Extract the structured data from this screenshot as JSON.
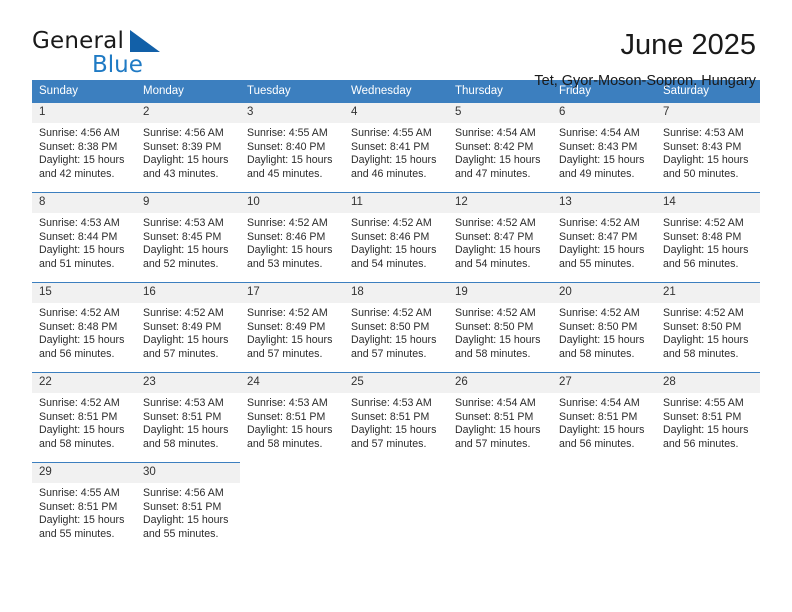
{
  "brand": {
    "name_top": "General",
    "name_bottom": "Blue",
    "triangle_icon": "triangle-icon",
    "accent_color": "#1f7ac4",
    "triangle_color": "#1260a8"
  },
  "header": {
    "title": "June 2025",
    "subtitle": "Tet, Gyor-Moson-Sopron, Hungary"
  },
  "calendar": {
    "header_bg": "#3c7fbf",
    "daynum_bg": "#f1f1f1",
    "weekdays": [
      "Sunday",
      "Monday",
      "Tuesday",
      "Wednesday",
      "Thursday",
      "Friday",
      "Saturday"
    ],
    "weeks": [
      [
        {
          "day": "1",
          "sunrise": "Sunrise: 4:56 AM",
          "sunset": "Sunset: 8:38 PM",
          "daylight1": "Daylight: 15 hours",
          "daylight2": "and 42 minutes."
        },
        {
          "day": "2",
          "sunrise": "Sunrise: 4:56 AM",
          "sunset": "Sunset: 8:39 PM",
          "daylight1": "Daylight: 15 hours",
          "daylight2": "and 43 minutes."
        },
        {
          "day": "3",
          "sunrise": "Sunrise: 4:55 AM",
          "sunset": "Sunset: 8:40 PM",
          "daylight1": "Daylight: 15 hours",
          "daylight2": "and 45 minutes."
        },
        {
          "day": "4",
          "sunrise": "Sunrise: 4:55 AM",
          "sunset": "Sunset: 8:41 PM",
          "daylight1": "Daylight: 15 hours",
          "daylight2": "and 46 minutes."
        },
        {
          "day": "5",
          "sunrise": "Sunrise: 4:54 AM",
          "sunset": "Sunset: 8:42 PM",
          "daylight1": "Daylight: 15 hours",
          "daylight2": "and 47 minutes."
        },
        {
          "day": "6",
          "sunrise": "Sunrise: 4:54 AM",
          "sunset": "Sunset: 8:43 PM",
          "daylight1": "Daylight: 15 hours",
          "daylight2": "and 49 minutes."
        },
        {
          "day": "7",
          "sunrise": "Sunrise: 4:53 AM",
          "sunset": "Sunset: 8:43 PM",
          "daylight1": "Daylight: 15 hours",
          "daylight2": "and 50 minutes."
        }
      ],
      [
        {
          "day": "8",
          "sunrise": "Sunrise: 4:53 AM",
          "sunset": "Sunset: 8:44 PM",
          "daylight1": "Daylight: 15 hours",
          "daylight2": "and 51 minutes."
        },
        {
          "day": "9",
          "sunrise": "Sunrise: 4:53 AM",
          "sunset": "Sunset: 8:45 PM",
          "daylight1": "Daylight: 15 hours",
          "daylight2": "and 52 minutes."
        },
        {
          "day": "10",
          "sunrise": "Sunrise: 4:52 AM",
          "sunset": "Sunset: 8:46 PM",
          "daylight1": "Daylight: 15 hours",
          "daylight2": "and 53 minutes."
        },
        {
          "day": "11",
          "sunrise": "Sunrise: 4:52 AM",
          "sunset": "Sunset: 8:46 PM",
          "daylight1": "Daylight: 15 hours",
          "daylight2": "and 54 minutes."
        },
        {
          "day": "12",
          "sunrise": "Sunrise: 4:52 AM",
          "sunset": "Sunset: 8:47 PM",
          "daylight1": "Daylight: 15 hours",
          "daylight2": "and 54 minutes."
        },
        {
          "day": "13",
          "sunrise": "Sunrise: 4:52 AM",
          "sunset": "Sunset: 8:47 PM",
          "daylight1": "Daylight: 15 hours",
          "daylight2": "and 55 minutes."
        },
        {
          "day": "14",
          "sunrise": "Sunrise: 4:52 AM",
          "sunset": "Sunset: 8:48 PM",
          "daylight1": "Daylight: 15 hours",
          "daylight2": "and 56 minutes."
        }
      ],
      [
        {
          "day": "15",
          "sunrise": "Sunrise: 4:52 AM",
          "sunset": "Sunset: 8:48 PM",
          "daylight1": "Daylight: 15 hours",
          "daylight2": "and 56 minutes."
        },
        {
          "day": "16",
          "sunrise": "Sunrise: 4:52 AM",
          "sunset": "Sunset: 8:49 PM",
          "daylight1": "Daylight: 15 hours",
          "daylight2": "and 57 minutes."
        },
        {
          "day": "17",
          "sunrise": "Sunrise: 4:52 AM",
          "sunset": "Sunset: 8:49 PM",
          "daylight1": "Daylight: 15 hours",
          "daylight2": "and 57 minutes."
        },
        {
          "day": "18",
          "sunrise": "Sunrise: 4:52 AM",
          "sunset": "Sunset: 8:50 PM",
          "daylight1": "Daylight: 15 hours",
          "daylight2": "and 57 minutes."
        },
        {
          "day": "19",
          "sunrise": "Sunrise: 4:52 AM",
          "sunset": "Sunset: 8:50 PM",
          "daylight1": "Daylight: 15 hours",
          "daylight2": "and 58 minutes."
        },
        {
          "day": "20",
          "sunrise": "Sunrise: 4:52 AM",
          "sunset": "Sunset: 8:50 PM",
          "daylight1": "Daylight: 15 hours",
          "daylight2": "and 58 minutes."
        },
        {
          "day": "21",
          "sunrise": "Sunrise: 4:52 AM",
          "sunset": "Sunset: 8:50 PM",
          "daylight1": "Daylight: 15 hours",
          "daylight2": "and 58 minutes."
        }
      ],
      [
        {
          "day": "22",
          "sunrise": "Sunrise: 4:52 AM",
          "sunset": "Sunset: 8:51 PM",
          "daylight1": "Daylight: 15 hours",
          "daylight2": "and 58 minutes."
        },
        {
          "day": "23",
          "sunrise": "Sunrise: 4:53 AM",
          "sunset": "Sunset: 8:51 PM",
          "daylight1": "Daylight: 15 hours",
          "daylight2": "and 58 minutes."
        },
        {
          "day": "24",
          "sunrise": "Sunrise: 4:53 AM",
          "sunset": "Sunset: 8:51 PM",
          "daylight1": "Daylight: 15 hours",
          "daylight2": "and 58 minutes."
        },
        {
          "day": "25",
          "sunrise": "Sunrise: 4:53 AM",
          "sunset": "Sunset: 8:51 PM",
          "daylight1": "Daylight: 15 hours",
          "daylight2": "and 57 minutes."
        },
        {
          "day": "26",
          "sunrise": "Sunrise: 4:54 AM",
          "sunset": "Sunset: 8:51 PM",
          "daylight1": "Daylight: 15 hours",
          "daylight2": "and 57 minutes."
        },
        {
          "day": "27",
          "sunrise": "Sunrise: 4:54 AM",
          "sunset": "Sunset: 8:51 PM",
          "daylight1": "Daylight: 15 hours",
          "daylight2": "and 56 minutes."
        },
        {
          "day": "28",
          "sunrise": "Sunrise: 4:55 AM",
          "sunset": "Sunset: 8:51 PM",
          "daylight1": "Daylight: 15 hours",
          "daylight2": "and 56 minutes."
        }
      ],
      [
        {
          "day": "29",
          "sunrise": "Sunrise: 4:55 AM",
          "sunset": "Sunset: 8:51 PM",
          "daylight1": "Daylight: 15 hours",
          "daylight2": "and 55 minutes."
        },
        {
          "day": "30",
          "sunrise": "Sunrise: 4:56 AM",
          "sunset": "Sunset: 8:51 PM",
          "daylight1": "Daylight: 15 hours",
          "daylight2": "and 55 minutes."
        },
        null,
        null,
        null,
        null,
        null
      ]
    ]
  }
}
